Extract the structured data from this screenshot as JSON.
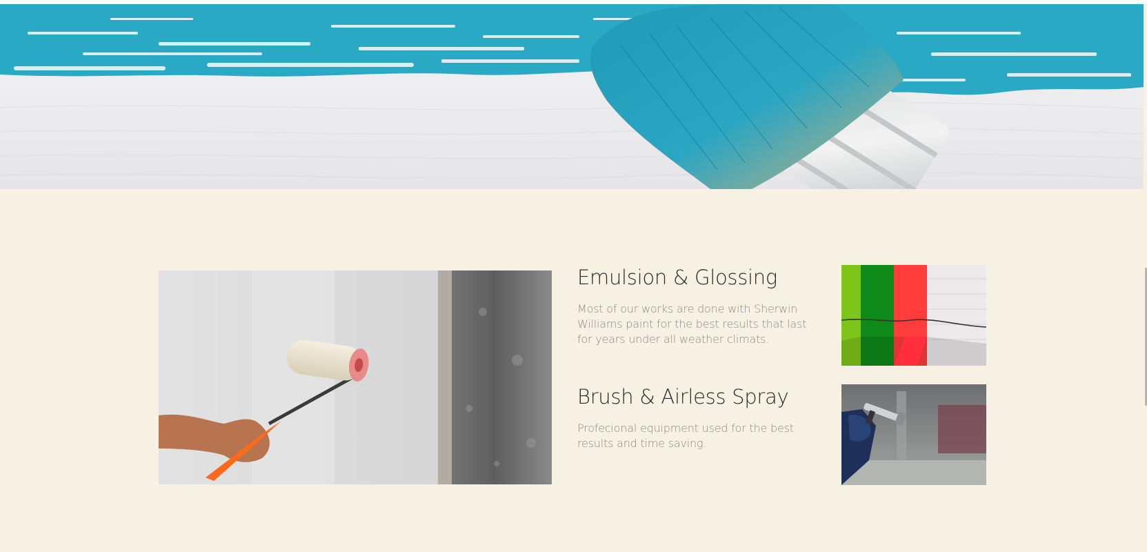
{
  "services": [
    {
      "title": "Emulsion & Glossing",
      "description": "Most of our works are done with Sherwin Williams paint for the best results that last for years under all weather climats."
    },
    {
      "title": "Brush & Airless Spray",
      "description": "Profecional equipment used for the best results and time saving."
    }
  ],
  "images": {
    "banner": "paint-brush-turquoise-banner",
    "main_photo": "paint-roller-on-wall-photo",
    "thumb_1": "green-red-painted-wall-photo",
    "thumb_2": "airless-spray-gun-photo"
  },
  "colors": {
    "background": "#f7f1e4",
    "turquoise": "#2aa9c4",
    "title_text": "#2a2a2a",
    "body_text": "#8a8a8a"
  }
}
